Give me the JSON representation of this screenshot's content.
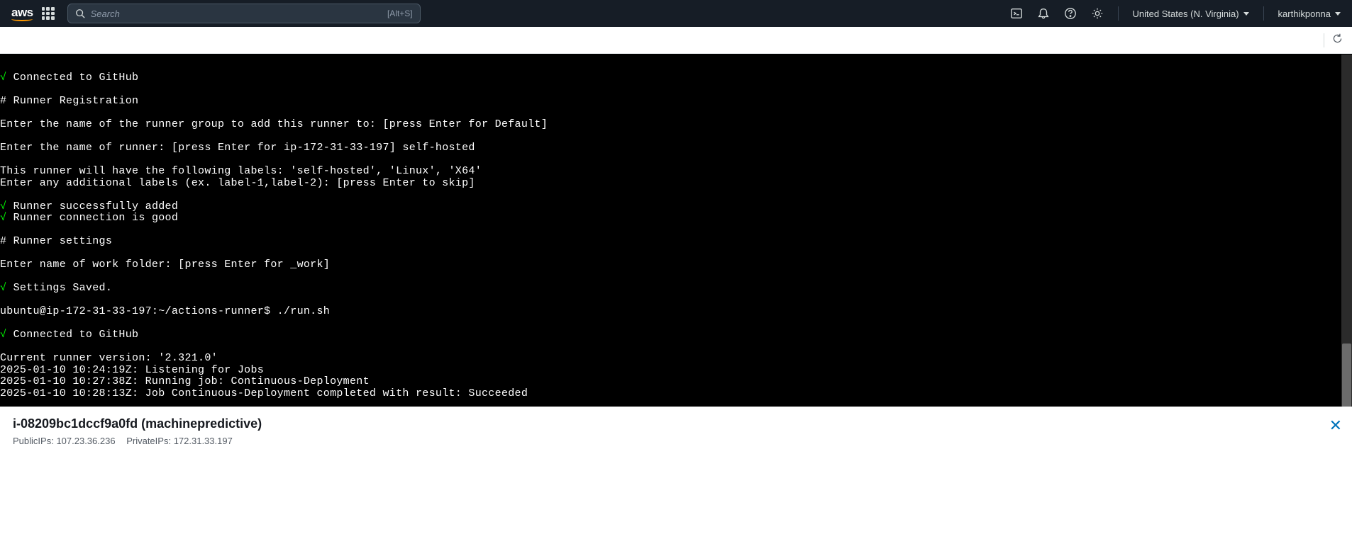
{
  "header": {
    "logo": "aws",
    "search_placeholder": "Search",
    "search_shortcut": "[Alt+S]",
    "region": "United States (N. Virginia)",
    "username": "karthikponna"
  },
  "terminal": {
    "lines": [
      {
        "check": true,
        "text": "Connected to GitHub"
      },
      {
        "text": ""
      },
      {
        "text": "# Runner Registration"
      },
      {
        "text": ""
      },
      {
        "text": "Enter the name of the runner group to add this runner to: [press Enter for Default]"
      },
      {
        "text": ""
      },
      {
        "text": "Enter the name of runner: [press Enter for ip-172-31-33-197] self-hosted"
      },
      {
        "text": ""
      },
      {
        "text": "This runner will have the following labels: 'self-hosted', 'Linux', 'X64'"
      },
      {
        "text": "Enter any additional labels (ex. label-1,label-2): [press Enter to skip]"
      },
      {
        "text": ""
      },
      {
        "check": true,
        "text": "Runner successfully added"
      },
      {
        "check": true,
        "text": "Runner connection is good"
      },
      {
        "text": ""
      },
      {
        "text": "# Runner settings"
      },
      {
        "text": ""
      },
      {
        "text": "Enter name of work folder: [press Enter for _work]"
      },
      {
        "text": ""
      },
      {
        "check": true,
        "text": "Settings Saved."
      },
      {
        "text": ""
      },
      {
        "text": "ubuntu@ip-172-31-33-197:~/actions-runner$ ./run.sh"
      },
      {
        "text": ""
      },
      {
        "check": true,
        "text": "Connected to GitHub"
      },
      {
        "text": ""
      },
      {
        "text": "Current runner version: '2.321.0'"
      },
      {
        "text": "2025-01-10 10:24:19Z: Listening for Jobs"
      },
      {
        "text": "2025-01-10 10:27:38Z: Running job: Continuous-Deployment"
      },
      {
        "text": "2025-01-10 10:28:13Z: Job Continuous-Deployment completed with result: Succeeded"
      }
    ]
  },
  "footer": {
    "instance_id": "i-08209bc1dccf9a0fd",
    "instance_name": "machinepredictive",
    "public_label": "PublicIPs:",
    "public_ip": "107.23.36.236",
    "private_label": "PrivateIPs:",
    "private_ip": "172.31.33.197"
  }
}
